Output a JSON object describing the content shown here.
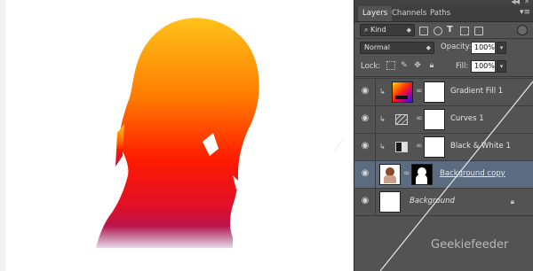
{
  "tabs": [
    {
      "label": "Layers",
      "active": true
    },
    {
      "label": "Channels",
      "active": false
    },
    {
      "label": "Paths",
      "active": false
    }
  ],
  "filter": {
    "kind_label": "Kind"
  },
  "blend_mode": "Normal",
  "opacity": {
    "label": "Opacity:",
    "value": "100%"
  },
  "lock": {
    "label": "Lock:"
  },
  "fill": {
    "label": "Fill:",
    "value": "100%"
  },
  "layers": [
    {
      "name": "Gradient Fill 1",
      "type": "gradient-fill",
      "clipped": true,
      "selected": false
    },
    {
      "name": "Curves 1",
      "type": "curves",
      "clipped": true,
      "selected": false
    },
    {
      "name": "Black & White 1",
      "type": "black-white",
      "clipped": true,
      "selected": false
    },
    {
      "name": "Background copy",
      "type": "pixel-with-mask",
      "clipped": false,
      "selected": true
    },
    {
      "name": "Background",
      "type": "background",
      "clipped": false,
      "selected": false
    }
  ],
  "watermark": "Geekiefeeder",
  "colors": {
    "panel_bg": "#535353",
    "selected_row": "#5c6c80",
    "gradient_top": "#ffc21a",
    "gradient_mid": "#ff1a00",
    "gradient_bottom": "#8b1a6a"
  }
}
